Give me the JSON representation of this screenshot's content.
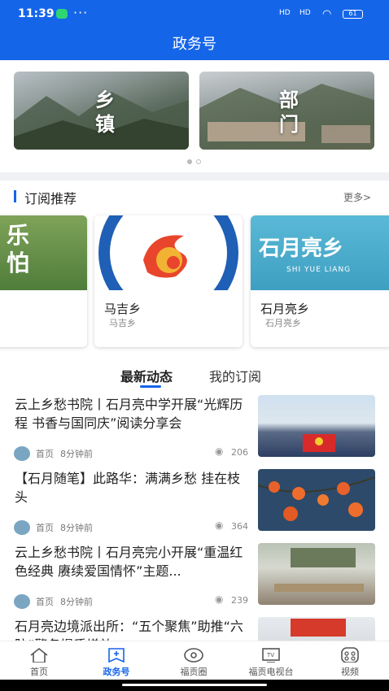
{
  "status_bar": {
    "time": "11:39",
    "dots": "···",
    "sig1": "HD",
    "sig2": "HD",
    "battery": "61"
  },
  "header": {
    "title": "政务号"
  },
  "banners": [
    {
      "label_line1": "乡",
      "label_line2": "镇"
    },
    {
      "label_line1": "部",
      "label_line2": "门"
    }
  ],
  "subscribe": {
    "title": "订阅推荐",
    "more": "更多>"
  },
  "cards": [
    {
      "logo_text": "乐 怕",
      "name": "",
      "sub": ""
    },
    {
      "logo_text": "",
      "name": "马吉乡",
      "sub": "马吉乡"
    },
    {
      "logo_text": "石月亮乡",
      "logo_sub": "SHI YUE LIANG",
      "name": "石月亮乡",
      "sub": "石月亮乡"
    }
  ],
  "tabs": {
    "latest": "最新动态",
    "mine": "我的订阅"
  },
  "news": [
    {
      "title": "云上乡愁书院丨石月亮中学开展“光辉历程 书香与国同庆”阅读分享会",
      "source": "首页",
      "time": "8分钟前",
      "views": "206"
    },
    {
      "title": "【石月随笔】此路华：满满乡愁 挂在枝头",
      "source": "首页",
      "time": "8分钟前",
      "views": "364"
    },
    {
      "title": "云上乡愁书院丨石月亮完小开展“重温红色经典 赓续爱国情怀”主题...",
      "source": "首页",
      "time": "8分钟前",
      "views": "239"
    },
    {
      "title": "石月亮边境派出所：“五个聚焦”助推“六防”警务提质增效",
      "source": "",
      "time": "",
      "views": ""
    }
  ],
  "tabbar": [
    {
      "label": "首页",
      "icon": "home-icon"
    },
    {
      "label": "政务号",
      "icon": "gov-icon"
    },
    {
      "label": "福贡圈",
      "icon": "circle-icon"
    },
    {
      "label": "福贡电视台",
      "icon": "tv-icon"
    },
    {
      "label": "视频",
      "icon": "video-icon"
    }
  ],
  "colors": {
    "accent": "#1565e8",
    "divider": "#f0f1f4"
  }
}
